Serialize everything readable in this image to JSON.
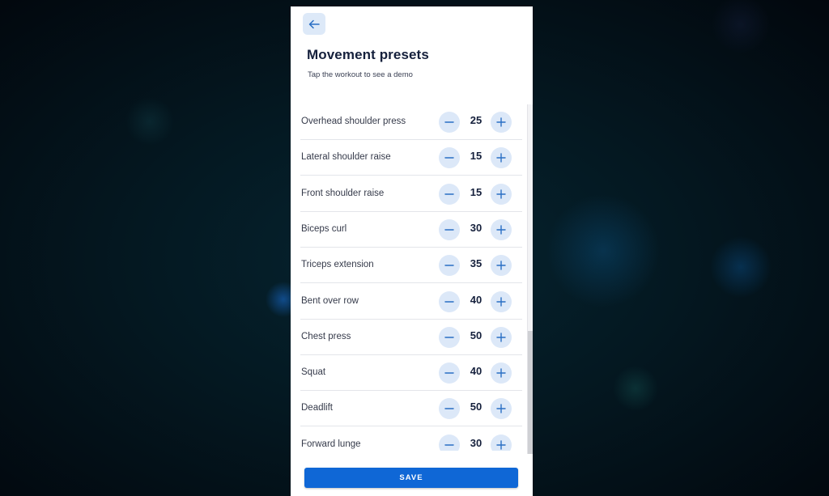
{
  "header": {
    "back_icon": "arrow-left-icon",
    "title": "Movement presets",
    "subtitle": "Tap the workout to see a demo"
  },
  "movements": [
    {
      "name": "Overhead shoulder press",
      "value": "25"
    },
    {
      "name": "Lateral shoulder raise",
      "value": "15"
    },
    {
      "name": "Front shoulder raise",
      "value": "15"
    },
    {
      "name": "Biceps curl",
      "value": "30"
    },
    {
      "name": "Triceps extension",
      "value": "35"
    },
    {
      "name": "Bent over row",
      "value": "40"
    },
    {
      "name": "Chest press",
      "value": "50"
    },
    {
      "name": "Squat",
      "value": "40"
    },
    {
      "name": "Deadlift",
      "value": "50"
    },
    {
      "name": "Forward lunge",
      "value": "30"
    }
  ],
  "stepper_icons": {
    "decrement": "minus-icon",
    "increment": "plus-icon"
  },
  "footer": {
    "save_label": "SAVE"
  },
  "colors": {
    "accent": "#0f67d6",
    "stepper_bg": "#dce8f8",
    "title_text": "#15203c",
    "icon_blue": "#2a6fc4"
  }
}
